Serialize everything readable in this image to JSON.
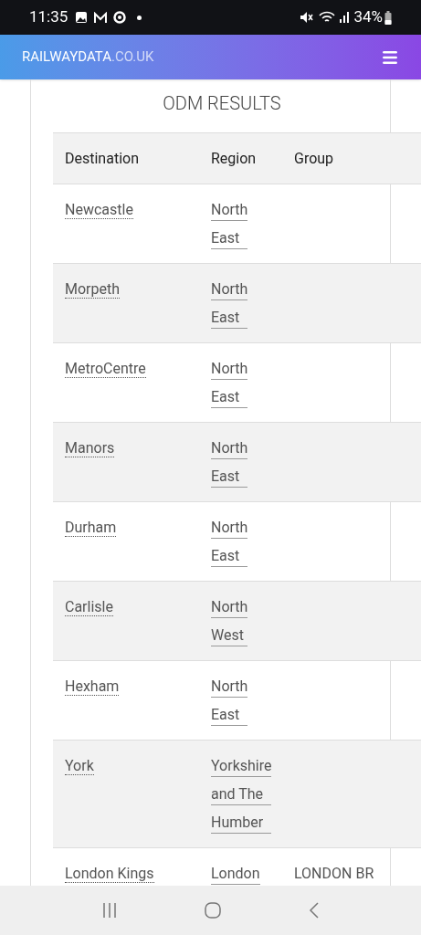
{
  "status_bar": {
    "time": "11:35",
    "battery": "34%"
  },
  "header": {
    "brand_bold": "RAILWAYDATA",
    "brand_light": ".CO.UK"
  },
  "title": "ODM RESULTS",
  "table": {
    "columns": [
      "Destination",
      "Region",
      "Group"
    ],
    "rows": [
      {
        "destination": "Newcastle",
        "region": "North East"
      },
      {
        "destination": "Morpeth",
        "region": "North East"
      },
      {
        "destination": "MetroCentre",
        "region": "North East"
      },
      {
        "destination": "Manors",
        "region": "North East"
      },
      {
        "destination": "Durham",
        "region": "North East"
      },
      {
        "destination": "Carlisle",
        "region": "North West"
      },
      {
        "destination": "Hexham",
        "region": "North East"
      },
      {
        "destination": "York",
        "region": "Yorkshire and The Humber"
      },
      {
        "destination": "London Kings",
        "region": "London",
        "group": "LONDON BR"
      }
    ]
  }
}
